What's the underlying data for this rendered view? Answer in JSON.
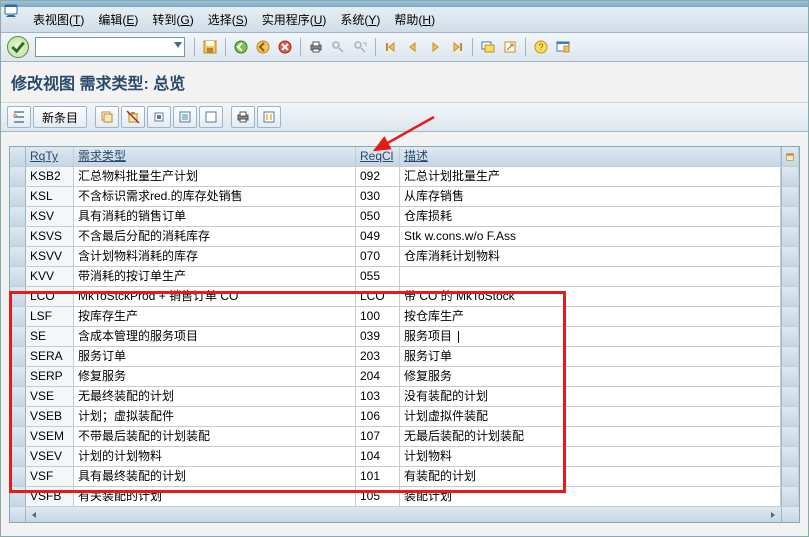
{
  "menubar": [
    {
      "label": "表视图",
      "key": "T"
    },
    {
      "label": "编辑",
      "key": "E"
    },
    {
      "label": "转到",
      "key": "G"
    },
    {
      "label": "选择",
      "key": "S"
    },
    {
      "label": "实用程序",
      "key": "U"
    },
    {
      "label": "系统",
      "key": "Y"
    },
    {
      "label": "帮助",
      "key": "H"
    }
  ],
  "title": "修改视图 需求类型: 总览",
  "app_toolbar": {
    "new_entries": "新条目"
  },
  "grid": {
    "headers": {
      "rqty": "RqTy",
      "rtype": "需求类型",
      "reqcl": "ReqCl",
      "desc": "描述"
    },
    "rows": [
      {
        "rqty": "KSB2",
        "rtype": "汇总物料批量生产计划",
        "reqcl": "092",
        "desc": "汇总计划批量生产"
      },
      {
        "rqty": "KSL",
        "rtype": "不含标识需求red.的库存处销售",
        "reqcl": "030",
        "desc": "从库存销售"
      },
      {
        "rqty": "KSV",
        "rtype": "具有消耗的销售订单",
        "reqcl": "050",
        "desc": "仓库损耗"
      },
      {
        "rqty": "KSVS",
        "rtype": "不含最后分配的消耗库存",
        "reqcl": "049",
        "desc": "Stk w.cons.w/o F.Ass"
      },
      {
        "rqty": "KSVV",
        "rtype": "含计划物料消耗的库存",
        "reqcl": "070",
        "desc": "仓库消耗计划物料"
      },
      {
        "rqty": "KVV",
        "rtype": "带消耗的按订单生产",
        "reqcl": "055",
        "desc": ""
      },
      {
        "rqty": "LCO",
        "rtype": "MkToStckProd + 销售订单 CO",
        "reqcl": "LCO",
        "desc": "带 CO 的 MkToStock"
      },
      {
        "rqty": "LSF",
        "rtype": "按库存生产",
        "reqcl": "100",
        "desc": "按仓库生产"
      },
      {
        "rqty": "SE",
        "rtype": "含成本管理的服务项目",
        "reqcl": "039",
        "desc": "服务项目",
        "cursor": true
      },
      {
        "rqty": "SERA",
        "rtype": "服务订单",
        "reqcl": "203",
        "desc": "服务订单"
      },
      {
        "rqty": "SERP",
        "rtype": "修复服务",
        "reqcl": "204",
        "desc": "修复服务"
      },
      {
        "rqty": "VSE",
        "rtype": "无最终装配的计划",
        "reqcl": "103",
        "desc": "没有装配的计划"
      },
      {
        "rqty": "VSEB",
        "rtype": "计划；虚拟装配件",
        "reqcl": "106",
        "desc": "计划虚拟件装配"
      },
      {
        "rqty": "VSEM",
        "rtype": "不带最后装配的计划装配",
        "reqcl": "107",
        "desc": "无最后装配的计划装配"
      },
      {
        "rqty": "VSEV",
        "rtype": "计划的计划物料",
        "reqcl": "104",
        "desc": "计划物料"
      },
      {
        "rqty": "VSF",
        "rtype": "具有最终装配的计划",
        "reqcl": "101",
        "desc": "有装配的计划"
      },
      {
        "rqty": "VSFB",
        "rtype": "有关装配的计划",
        "reqcl": "105",
        "desc": "装配计划"
      }
    ]
  }
}
